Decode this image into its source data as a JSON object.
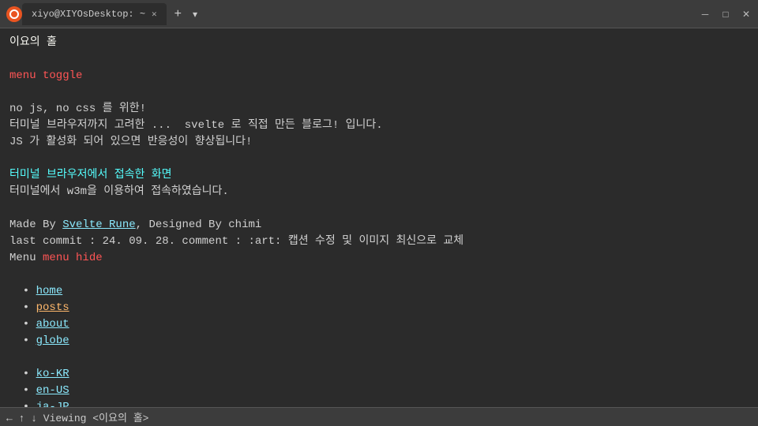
{
  "titlebar": {
    "title": "xiyo@XIYOsDesktop: ~",
    "tab_label": "xiyo@XIYOsDesktop: ~",
    "close_label": "✕",
    "minimize_label": "─",
    "maximize_label": "□",
    "new_tab_label": "+",
    "dropdown_label": "▾"
  },
  "terminal": {
    "line1": "이요의 홀",
    "line2": "",
    "line3_prefix": "",
    "line3": "menu toggle",
    "line4": "",
    "line5": "no js, no css 를 위한!",
    "line6": "터미널 브라우저까지 고려한 ...  svelte 로 직접 만든 블로그! 입니다.",
    "line7": "JS 가 활성화 되어 있으면 반응성이 향상됩니다!",
    "line8": "",
    "line9": "터미널 브라우저에서 접속한 화면",
    "line10": "터미널에서 w3m을 이용하여 접속하였습니다.",
    "line11": "",
    "line12_prefix": "Made By ",
    "line12_link": "Svelte Rune",
    "line12_middle": ", Designed By chimi",
    "line13": "last commit : 24. 09. 28. comment : :art: 캡션 수정 및 이미지 최신으로 교체",
    "line14_prefix": "Menu ",
    "line14_link": "menu hide",
    "line15": "",
    "nav_items": [
      {
        "label": "home",
        "link": true
      },
      {
        "label": "posts",
        "link": true
      },
      {
        "label": "about",
        "link": true
      },
      {
        "label": "globe",
        "link": true
      }
    ],
    "line_blank": "",
    "lang_items": [
      {
        "label": "ko-KR",
        "link": true
      },
      {
        "label": "en-US",
        "link": true
      },
      {
        "label": "ja-JP",
        "link": true
      }
    ]
  },
  "statusbar": {
    "text": "← ↑ ↓ Viewing <이요의 홀>"
  }
}
